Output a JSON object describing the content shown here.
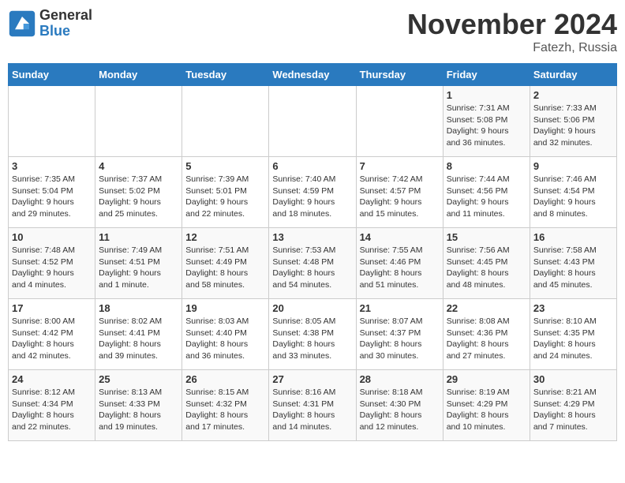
{
  "logo": {
    "general": "General",
    "blue": "Blue"
  },
  "title": "November 2024",
  "location": "Fatezh, Russia",
  "days_header": [
    "Sunday",
    "Monday",
    "Tuesday",
    "Wednesday",
    "Thursday",
    "Friday",
    "Saturday"
  ],
  "weeks": [
    [
      {
        "day": "",
        "info": ""
      },
      {
        "day": "",
        "info": ""
      },
      {
        "day": "",
        "info": ""
      },
      {
        "day": "",
        "info": ""
      },
      {
        "day": "",
        "info": ""
      },
      {
        "day": "1",
        "info": "Sunrise: 7:31 AM\nSunset: 5:08 PM\nDaylight: 9 hours\nand 36 minutes."
      },
      {
        "day": "2",
        "info": "Sunrise: 7:33 AM\nSunset: 5:06 PM\nDaylight: 9 hours\nand 32 minutes."
      }
    ],
    [
      {
        "day": "3",
        "info": "Sunrise: 7:35 AM\nSunset: 5:04 PM\nDaylight: 9 hours\nand 29 minutes."
      },
      {
        "day": "4",
        "info": "Sunrise: 7:37 AM\nSunset: 5:02 PM\nDaylight: 9 hours\nand 25 minutes."
      },
      {
        "day": "5",
        "info": "Sunrise: 7:39 AM\nSunset: 5:01 PM\nDaylight: 9 hours\nand 22 minutes."
      },
      {
        "day": "6",
        "info": "Sunrise: 7:40 AM\nSunset: 4:59 PM\nDaylight: 9 hours\nand 18 minutes."
      },
      {
        "day": "7",
        "info": "Sunrise: 7:42 AM\nSunset: 4:57 PM\nDaylight: 9 hours\nand 15 minutes."
      },
      {
        "day": "8",
        "info": "Sunrise: 7:44 AM\nSunset: 4:56 PM\nDaylight: 9 hours\nand 11 minutes."
      },
      {
        "day": "9",
        "info": "Sunrise: 7:46 AM\nSunset: 4:54 PM\nDaylight: 9 hours\nand 8 minutes."
      }
    ],
    [
      {
        "day": "10",
        "info": "Sunrise: 7:48 AM\nSunset: 4:52 PM\nDaylight: 9 hours\nand 4 minutes."
      },
      {
        "day": "11",
        "info": "Sunrise: 7:49 AM\nSunset: 4:51 PM\nDaylight: 9 hours\nand 1 minute."
      },
      {
        "day": "12",
        "info": "Sunrise: 7:51 AM\nSunset: 4:49 PM\nDaylight: 8 hours\nand 58 minutes."
      },
      {
        "day": "13",
        "info": "Sunrise: 7:53 AM\nSunset: 4:48 PM\nDaylight: 8 hours\nand 54 minutes."
      },
      {
        "day": "14",
        "info": "Sunrise: 7:55 AM\nSunset: 4:46 PM\nDaylight: 8 hours\nand 51 minutes."
      },
      {
        "day": "15",
        "info": "Sunrise: 7:56 AM\nSunset: 4:45 PM\nDaylight: 8 hours\nand 48 minutes."
      },
      {
        "day": "16",
        "info": "Sunrise: 7:58 AM\nSunset: 4:43 PM\nDaylight: 8 hours\nand 45 minutes."
      }
    ],
    [
      {
        "day": "17",
        "info": "Sunrise: 8:00 AM\nSunset: 4:42 PM\nDaylight: 8 hours\nand 42 minutes."
      },
      {
        "day": "18",
        "info": "Sunrise: 8:02 AM\nSunset: 4:41 PM\nDaylight: 8 hours\nand 39 minutes."
      },
      {
        "day": "19",
        "info": "Sunrise: 8:03 AM\nSunset: 4:40 PM\nDaylight: 8 hours\nand 36 minutes."
      },
      {
        "day": "20",
        "info": "Sunrise: 8:05 AM\nSunset: 4:38 PM\nDaylight: 8 hours\nand 33 minutes."
      },
      {
        "day": "21",
        "info": "Sunrise: 8:07 AM\nSunset: 4:37 PM\nDaylight: 8 hours\nand 30 minutes."
      },
      {
        "day": "22",
        "info": "Sunrise: 8:08 AM\nSunset: 4:36 PM\nDaylight: 8 hours\nand 27 minutes."
      },
      {
        "day": "23",
        "info": "Sunrise: 8:10 AM\nSunset: 4:35 PM\nDaylight: 8 hours\nand 24 minutes."
      }
    ],
    [
      {
        "day": "24",
        "info": "Sunrise: 8:12 AM\nSunset: 4:34 PM\nDaylight: 8 hours\nand 22 minutes."
      },
      {
        "day": "25",
        "info": "Sunrise: 8:13 AM\nSunset: 4:33 PM\nDaylight: 8 hours\nand 19 minutes."
      },
      {
        "day": "26",
        "info": "Sunrise: 8:15 AM\nSunset: 4:32 PM\nDaylight: 8 hours\nand 17 minutes."
      },
      {
        "day": "27",
        "info": "Sunrise: 8:16 AM\nSunset: 4:31 PM\nDaylight: 8 hours\nand 14 minutes."
      },
      {
        "day": "28",
        "info": "Sunrise: 8:18 AM\nSunset: 4:30 PM\nDaylight: 8 hours\nand 12 minutes."
      },
      {
        "day": "29",
        "info": "Sunrise: 8:19 AM\nSunset: 4:29 PM\nDaylight: 8 hours\nand 10 minutes."
      },
      {
        "day": "30",
        "info": "Sunrise: 8:21 AM\nSunset: 4:29 PM\nDaylight: 8 hours\nand 7 minutes."
      }
    ]
  ]
}
